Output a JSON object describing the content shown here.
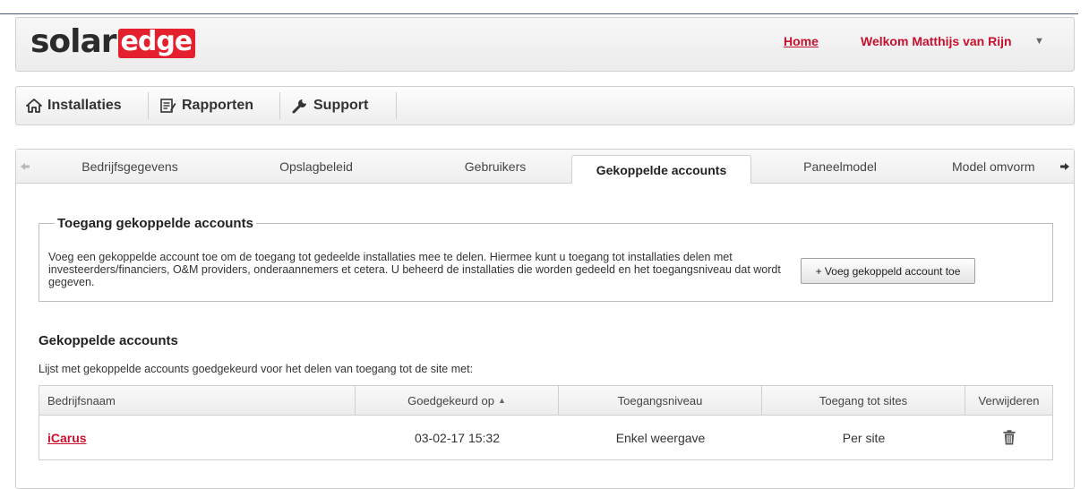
{
  "brand": {
    "part1": "solar",
    "part2": "edge"
  },
  "header": {
    "home_link": "Home",
    "welcome_text": "Welkom Matthijs van Rijn",
    "welcome_caret": "▼"
  },
  "nav": {
    "items": [
      {
        "label": "Installaties",
        "icon": "home-icon"
      },
      {
        "label": "Rapporten",
        "icon": "report-icon"
      },
      {
        "label": "Support",
        "icon": "wrench-icon"
      }
    ]
  },
  "tabs": {
    "items": [
      {
        "label": "Bedrijfsgegevens",
        "active": false
      },
      {
        "label": "Opslagbeleid",
        "active": false
      },
      {
        "label": "Gebruikers",
        "active": false
      },
      {
        "label": "Gekoppelde accounts",
        "active": true
      },
      {
        "label": "Paneelmodel",
        "active": false
      },
      {
        "label": "Model omvorm",
        "active": false
      }
    ]
  },
  "access_section": {
    "legend": "Toegang gekoppelde accounts",
    "description": "Voeg een gekoppelde account toe om de toegang tot gedeelde installaties mee te delen. Hiermee kunt u toegang tot installaties delen met investeerders/financiers, O&M providers, onderaannemers et cetera. U beheerd de installaties die worden gedeeld en het toegangsniveau dat wordt gegeven.",
    "add_button": "+ Voeg gekoppeld account toe"
  },
  "accounts": {
    "title": "Gekoppelde accounts",
    "description": "Lijst met gekoppelde accounts goedgekeurd voor het delen van toegang tot de site met:",
    "columns": [
      "Bedrijfsnaam",
      "Goedgekeurd op",
      "Toegangsniveau",
      "Toegang tot sites",
      "Verwijderen"
    ],
    "sort_indicator": "▲",
    "rows": [
      {
        "company": "iCarus",
        "approved_on": "03-02-17 15:32",
        "access_level": "Enkel weergave",
        "site_access": "Per site"
      }
    ]
  },
  "colors": {
    "brand_red": "#e4202e",
    "link_red": "#c8102e",
    "border": "#cfcfcf"
  }
}
